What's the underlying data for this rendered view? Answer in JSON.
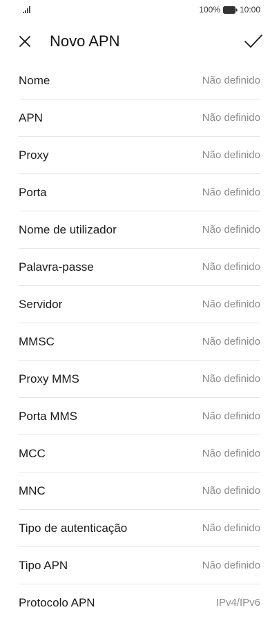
{
  "status_bar": {
    "signal_icon": "signal-bars-icon",
    "battery_percent": "100%",
    "battery_icon": "battery-full-icon",
    "time": "10:00"
  },
  "app_bar": {
    "close_icon": "close-icon",
    "title": "Novo APN",
    "confirm_icon": "checkmark-icon"
  },
  "fields": [
    {
      "label": "Nome",
      "value": "Não definido"
    },
    {
      "label": "APN",
      "value": "Não definido"
    },
    {
      "label": "Proxy",
      "value": "Não definido"
    },
    {
      "label": "Porta",
      "value": "Não definido"
    },
    {
      "label": "Nome de utilizador",
      "value": "Não definido"
    },
    {
      "label": "Palavra-passe",
      "value": "Não definido"
    },
    {
      "label": "Servidor",
      "value": "Não definido"
    },
    {
      "label": "MMSC",
      "value": "Não definido"
    },
    {
      "label": "Proxy MMS",
      "value": "Não definido"
    },
    {
      "label": "Porta MMS",
      "value": "Não definido"
    },
    {
      "label": "MCC",
      "value": "Não definido"
    },
    {
      "label": "MNC",
      "value": "Não definido"
    },
    {
      "label": "Tipo de autenticação",
      "value": "Não definido"
    },
    {
      "label": "Tipo APN",
      "value": "Não definido"
    },
    {
      "label": "Protocolo APN",
      "value": "IPv4/IPv6"
    }
  ]
}
